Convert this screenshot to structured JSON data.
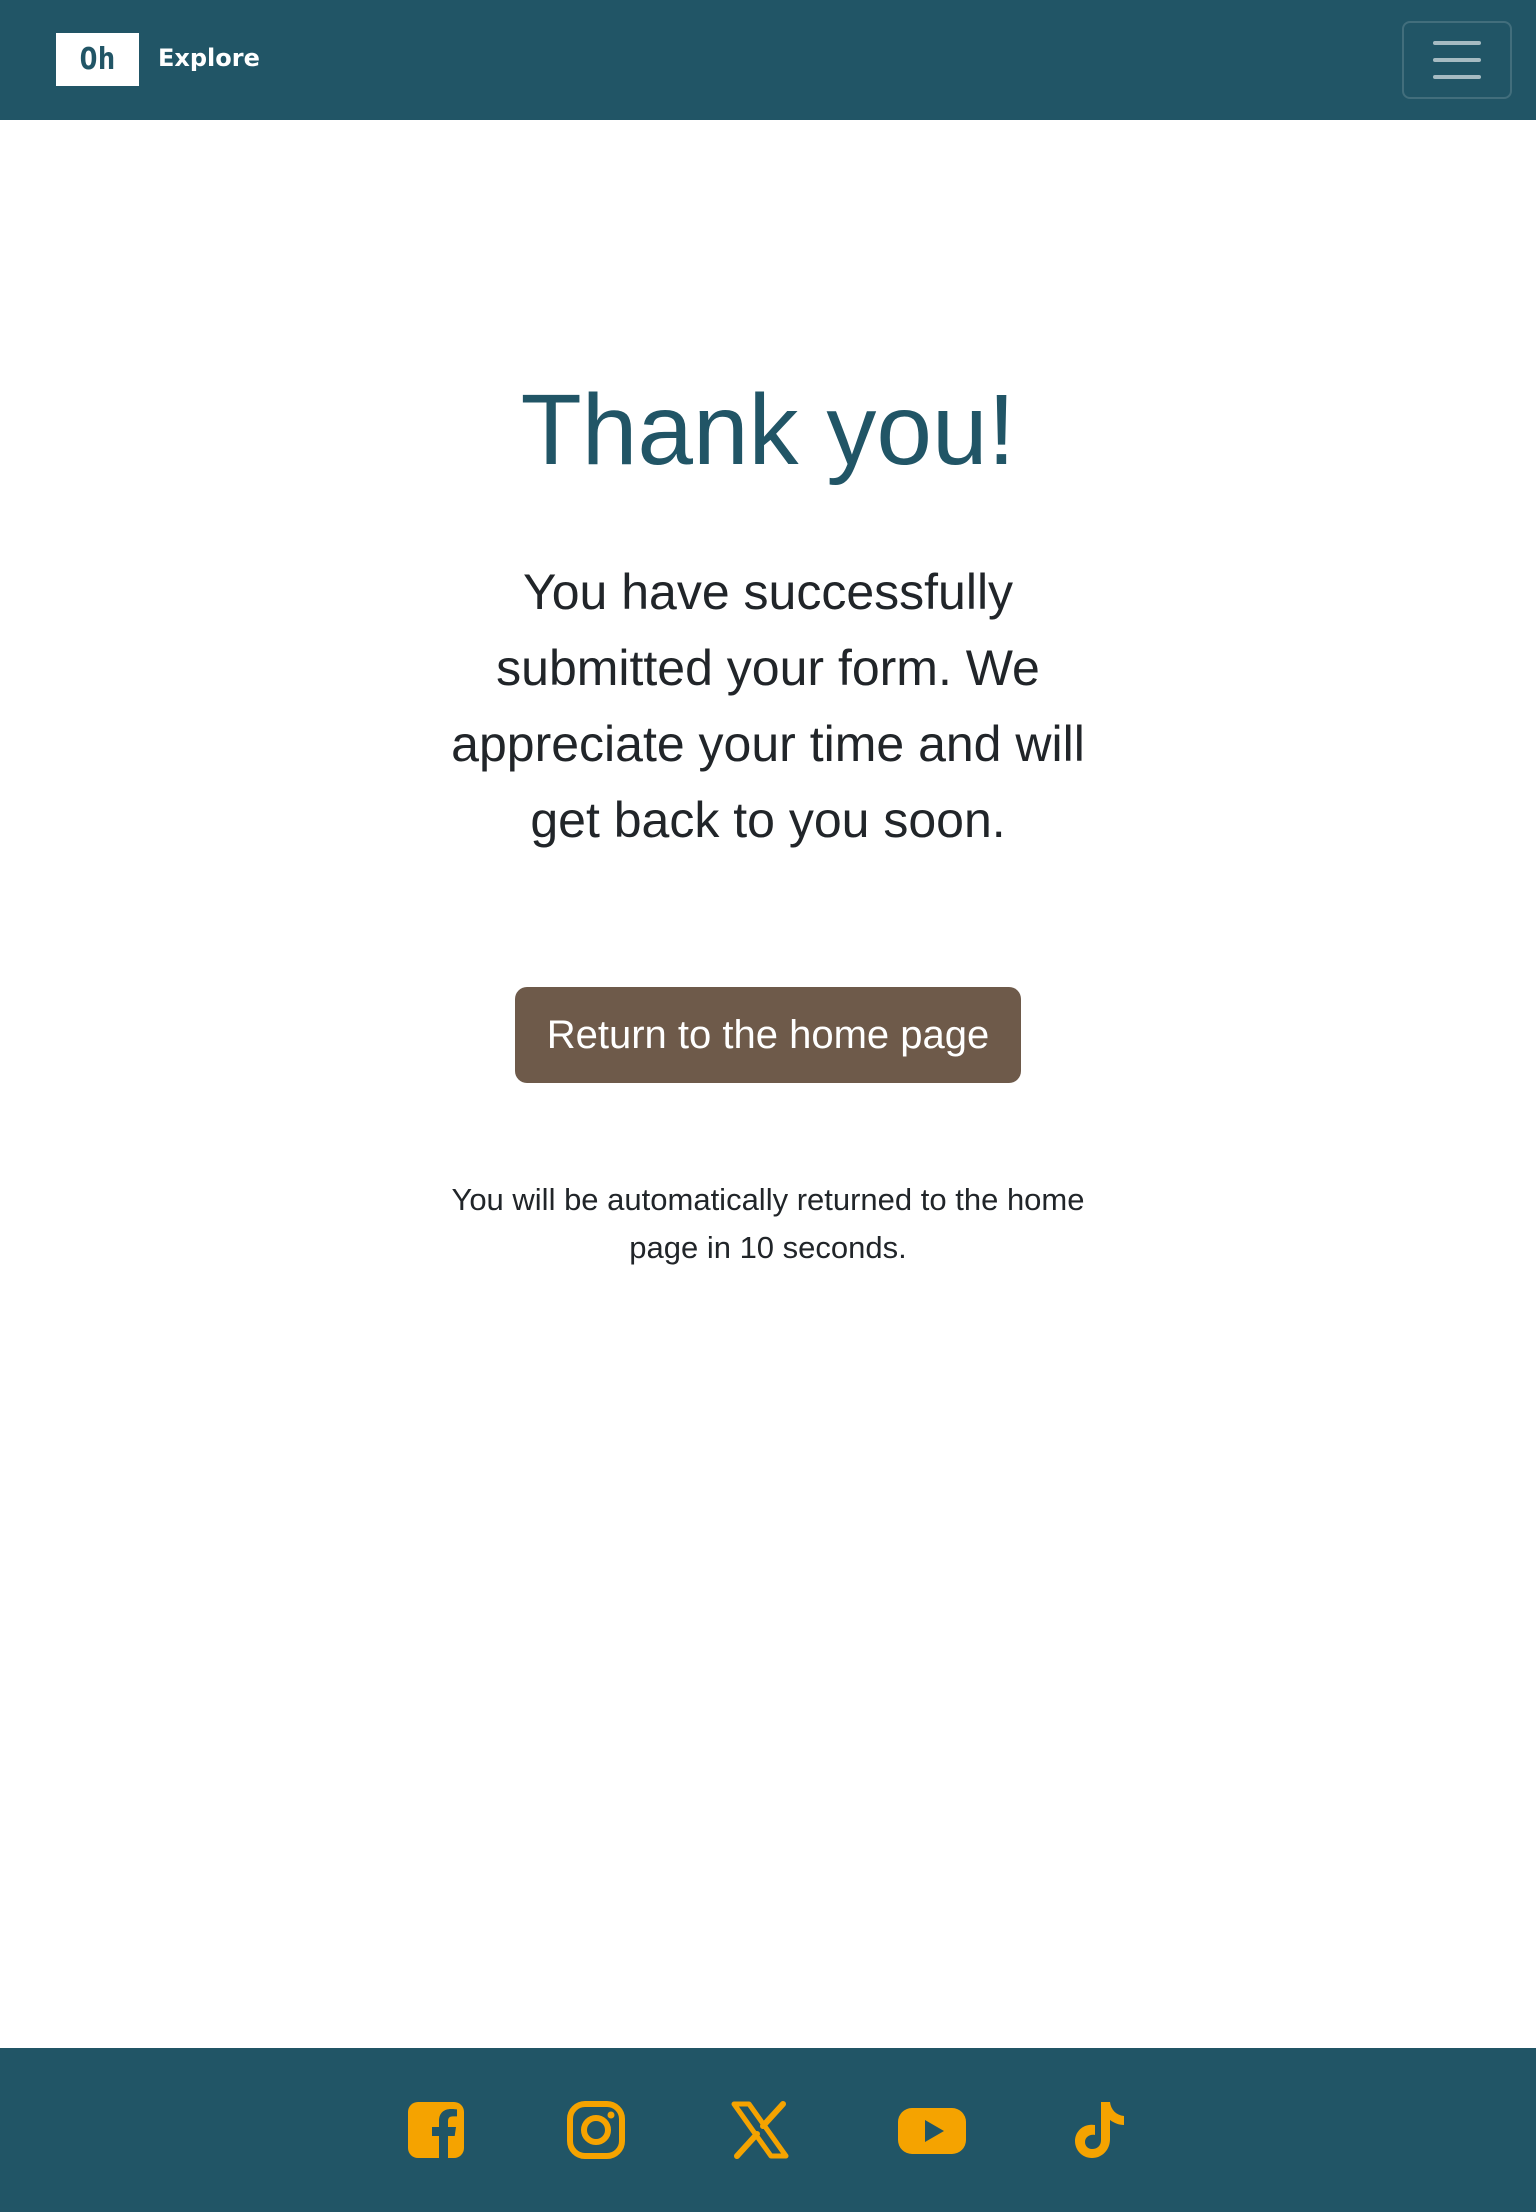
{
  "header": {
    "logo_text": "Oh",
    "brand_name": "Explore",
    "menu_icon": "hamburger-icon"
  },
  "main": {
    "title": "Thank you!",
    "message": "You have successfully submitted your form. We appreciate your time and will get back to you soon.",
    "home_button_label": "Return to the home page",
    "redirect_note": "You will be automatically returned to the home page in 10 seconds."
  },
  "footer": {
    "social_icons": [
      "facebook-icon",
      "instagram-icon",
      "x-icon",
      "youtube-icon",
      "tiktok-icon"
    ]
  },
  "colors": {
    "primary": "#215566",
    "button": "#6e5a4a",
    "icon_accent": "#f5a300",
    "text": "#212529"
  }
}
